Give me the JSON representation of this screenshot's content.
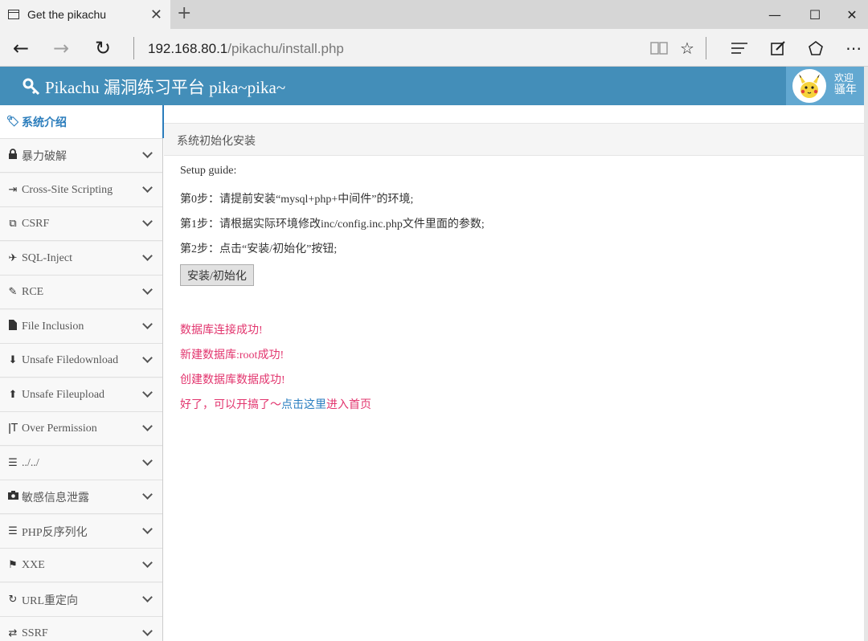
{
  "browser": {
    "tab_title": "Get the pikachu",
    "url_host": "192.168.80.1",
    "url_path": "/pikachu/install.php"
  },
  "header": {
    "title": "Pikachu 漏洞练习平台 pika~pika~",
    "welcome": "欢迎",
    "username": "骚年",
    "accent_color": "#438eb9"
  },
  "sidebar": {
    "items": [
      {
        "label": "系统介绍",
        "icon": "tags-icon"
      },
      {
        "label": "暴力破解",
        "icon": "lock-icon"
      },
      {
        "label": "Cross-Site Scripting",
        "icon": "list-indent-icon"
      },
      {
        "label": "CSRF",
        "icon": "external-link-icon"
      },
      {
        "label": "SQL-Inject",
        "icon": "fighter-jet-icon"
      },
      {
        "label": "RCE",
        "icon": "pencil-icon"
      },
      {
        "label": "File Inclusion",
        "icon": "file-icon"
      },
      {
        "label": "Unsafe Filedownload",
        "icon": "download-circle-icon"
      },
      {
        "label": "Unsafe Fileupload",
        "icon": "upload-circle-icon"
      },
      {
        "label": "Over Permission",
        "icon": "text-height-icon"
      },
      {
        "label": "../../",
        "icon": "align-left-icon"
      },
      {
        "label": "敏感信息泄露",
        "icon": "camera-icon"
      },
      {
        "label": "PHP反序列化",
        "icon": "align-justify-icon"
      },
      {
        "label": "XXE",
        "icon": "flag-icon"
      },
      {
        "label": "URL重定向",
        "icon": "refresh-icon"
      },
      {
        "label": "SSRF",
        "icon": "exchange-icon"
      }
    ]
  },
  "main": {
    "breadcrumb": "系统初始化安装",
    "setup_guide": "Setup guide:",
    "step0": "第0步：请提前安装“mysql+php+中间件”的环境;",
    "step1": "第1步：请根据实际环境修改inc/config.inc.php文件里面的参数;",
    "step2": "第2步：点击“安装/初始化”按钮;",
    "install_button": "安装/初始化",
    "messages": {
      "db_connect": "数据库连接成功!",
      "db_create": "新建数据库:root成功!",
      "db_data": "创建数据库数据成功!",
      "ready_prefix": "好了，可以开搞了～",
      "ready_link": "点击这里",
      "ready_suffix": "进入首页"
    },
    "message_color": "#e2356e",
    "link_color": "#2a7ec0"
  }
}
